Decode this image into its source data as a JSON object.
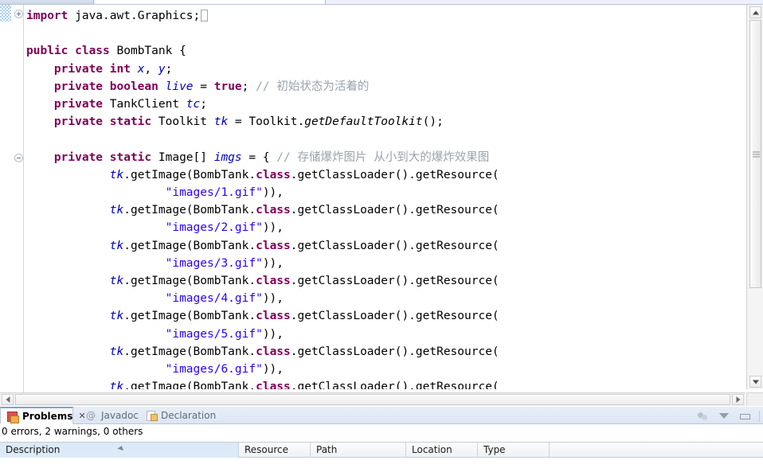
{
  "editor": {
    "tabs": [
      "",
      "",
      ""
    ],
    "current_line_index": 0,
    "code_lines": [
      {
        "indent": 0,
        "tokens": [
          {
            "t": "import",
            "c": "kw"
          },
          {
            "t": " java.awt.Graphics;",
            "c": "plain"
          }
        ],
        "caret": true
      },
      {
        "indent": 0,
        "tokens": []
      },
      {
        "indent": 0,
        "tokens": [
          {
            "t": "public class ",
            "c": "kw"
          },
          {
            "t": "BombTank {",
            "c": "plain"
          }
        ]
      },
      {
        "indent": 1,
        "tokens": [
          {
            "t": "private int ",
            "c": "kw"
          },
          {
            "t": "x",
            "c": "fld"
          },
          {
            "t": ", ",
            "c": "plain"
          },
          {
            "t": "y",
            "c": "fld"
          },
          {
            "t": ";",
            "c": "plain"
          }
        ]
      },
      {
        "indent": 1,
        "tokens": [
          {
            "t": "private boolean ",
            "c": "kw"
          },
          {
            "t": "live",
            "c": "fld"
          },
          {
            "t": " = ",
            "c": "plain"
          },
          {
            "t": "true",
            "c": "kw"
          },
          {
            "t": "; ",
            "c": "plain"
          },
          {
            "t": "// 初始状态为活着的",
            "c": "cmt"
          }
        ]
      },
      {
        "indent": 1,
        "tokens": [
          {
            "t": "private ",
            "c": "kw"
          },
          {
            "t": "TankClient ",
            "c": "plain"
          },
          {
            "t": "tc",
            "c": "fld"
          },
          {
            "t": ";",
            "c": "plain"
          }
        ]
      },
      {
        "indent": 1,
        "tokens": [
          {
            "t": "private static ",
            "c": "kw"
          },
          {
            "t": "Toolkit ",
            "c": "plain"
          },
          {
            "t": "tk",
            "c": "sfld"
          },
          {
            "t": " = Toolkit.",
            "c": "plain"
          },
          {
            "t": "getDefaultToolkit",
            "c": "smeth"
          },
          {
            "t": "();",
            "c": "plain"
          }
        ]
      },
      {
        "indent": 0,
        "tokens": []
      },
      {
        "indent": 1,
        "tokens": [
          {
            "t": "private static ",
            "c": "kw"
          },
          {
            "t": "Image[] ",
            "c": "plain"
          },
          {
            "t": "imgs",
            "c": "sfld"
          },
          {
            "t": " = { ",
            "c": "plain"
          },
          {
            "t": "// 存储爆炸图片 从小到大的爆炸效果图",
            "c": "cmt"
          }
        ],
        "fold": "minus"
      },
      {
        "indent": 3,
        "tokens": [
          {
            "t": "tk",
            "c": "sfld"
          },
          {
            "t": ".getImage(BombTank.",
            "c": "plain"
          },
          {
            "t": "class",
            "c": "kw"
          },
          {
            "t": ".getClassLoader().getResource(",
            "c": "plain"
          }
        ]
      },
      {
        "indent": 5,
        "tokens": [
          {
            "t": "\"images/1.gif\"",
            "c": "str"
          },
          {
            "t": ")),",
            "c": "plain"
          }
        ]
      },
      {
        "indent": 3,
        "tokens": [
          {
            "t": "tk",
            "c": "sfld"
          },
          {
            "t": ".getImage(BombTank.",
            "c": "plain"
          },
          {
            "t": "class",
            "c": "kw"
          },
          {
            "t": ".getClassLoader().getResource(",
            "c": "plain"
          }
        ]
      },
      {
        "indent": 5,
        "tokens": [
          {
            "t": "\"images/2.gif\"",
            "c": "str"
          },
          {
            "t": ")),",
            "c": "plain"
          }
        ]
      },
      {
        "indent": 3,
        "tokens": [
          {
            "t": "tk",
            "c": "sfld"
          },
          {
            "t": ".getImage(BombTank.",
            "c": "plain"
          },
          {
            "t": "class",
            "c": "kw"
          },
          {
            "t": ".getClassLoader().getResource(",
            "c": "plain"
          }
        ]
      },
      {
        "indent": 5,
        "tokens": [
          {
            "t": "\"images/3.gif\"",
            "c": "str"
          },
          {
            "t": ")),",
            "c": "plain"
          }
        ]
      },
      {
        "indent": 3,
        "tokens": [
          {
            "t": "tk",
            "c": "sfld"
          },
          {
            "t": ".getImage(BombTank.",
            "c": "plain"
          },
          {
            "t": "class",
            "c": "kw"
          },
          {
            "t": ".getClassLoader().getResource(",
            "c": "plain"
          }
        ]
      },
      {
        "indent": 5,
        "tokens": [
          {
            "t": "\"images/4.gif\"",
            "c": "str"
          },
          {
            "t": ")),",
            "c": "plain"
          }
        ]
      },
      {
        "indent": 3,
        "tokens": [
          {
            "t": "tk",
            "c": "sfld"
          },
          {
            "t": ".getImage(BombTank.",
            "c": "plain"
          },
          {
            "t": "class",
            "c": "kw"
          },
          {
            "t": ".getClassLoader().getResource(",
            "c": "plain"
          }
        ]
      },
      {
        "indent": 5,
        "tokens": [
          {
            "t": "\"images/5.gif\"",
            "c": "str"
          },
          {
            "t": ")),",
            "c": "plain"
          }
        ]
      },
      {
        "indent": 3,
        "tokens": [
          {
            "t": "tk",
            "c": "sfld"
          },
          {
            "t": ".getImage(BombTank.",
            "c": "plain"
          },
          {
            "t": "class",
            "c": "kw"
          },
          {
            "t": ".getClassLoader().getResource(",
            "c": "plain"
          }
        ]
      },
      {
        "indent": 5,
        "tokens": [
          {
            "t": "\"images/6.gif\"",
            "c": "str"
          },
          {
            "t": ")),",
            "c": "plain"
          }
        ]
      },
      {
        "indent": 3,
        "tokens": [
          {
            "t": "tk",
            "c": "sfld"
          },
          {
            "t": ".getImage(BombTank.",
            "c": "plain"
          },
          {
            "t": "class",
            "c": "kw"
          },
          {
            "t": ".getClassLoader().getResource(",
            "c": "plain"
          }
        ]
      }
    ],
    "scrollbars": {
      "vertical_up_icon": "arrow-up-icon",
      "vertical_down_icon": "arrow-down-icon",
      "horizontal_left_icon": "arrow-left-icon",
      "horizontal_right_icon": "arrow-right-icon"
    }
  },
  "bottom_view": {
    "tabs": [
      {
        "label": "Problems",
        "icon": "problems-icon",
        "active": true,
        "closable": true
      },
      {
        "label": "Javadoc",
        "icon": "at-icon",
        "active": false,
        "closable": false
      },
      {
        "label": "Declaration",
        "icon": "declaration-icon",
        "active": false,
        "closable": false
      }
    ],
    "close_glyph": "✕",
    "toolbar": [
      {
        "name": "focus-on-selection-icon"
      },
      {
        "name": "filter-icon"
      },
      {
        "name": "minimize-icon"
      }
    ],
    "status": "0 errors, 2 warnings, 0 others",
    "table": {
      "columns": [
        {
          "label": "Description",
          "sorted": true
        },
        {
          "label": "Resource",
          "sorted": false
        },
        {
          "label": "Path",
          "sorted": false
        },
        {
          "label": "Location",
          "sorted": false
        },
        {
          "label": "Type",
          "sorted": false
        }
      ],
      "rows": []
    }
  },
  "colors": {
    "keyword": "#7f0055",
    "string": "#2a00ff",
    "comment": "#9aa3ad",
    "field": "#0000c0",
    "current_line": "#eaf3fd",
    "tab_active_border": "#7ba3d0",
    "sorted_column": "#dceaf7"
  }
}
